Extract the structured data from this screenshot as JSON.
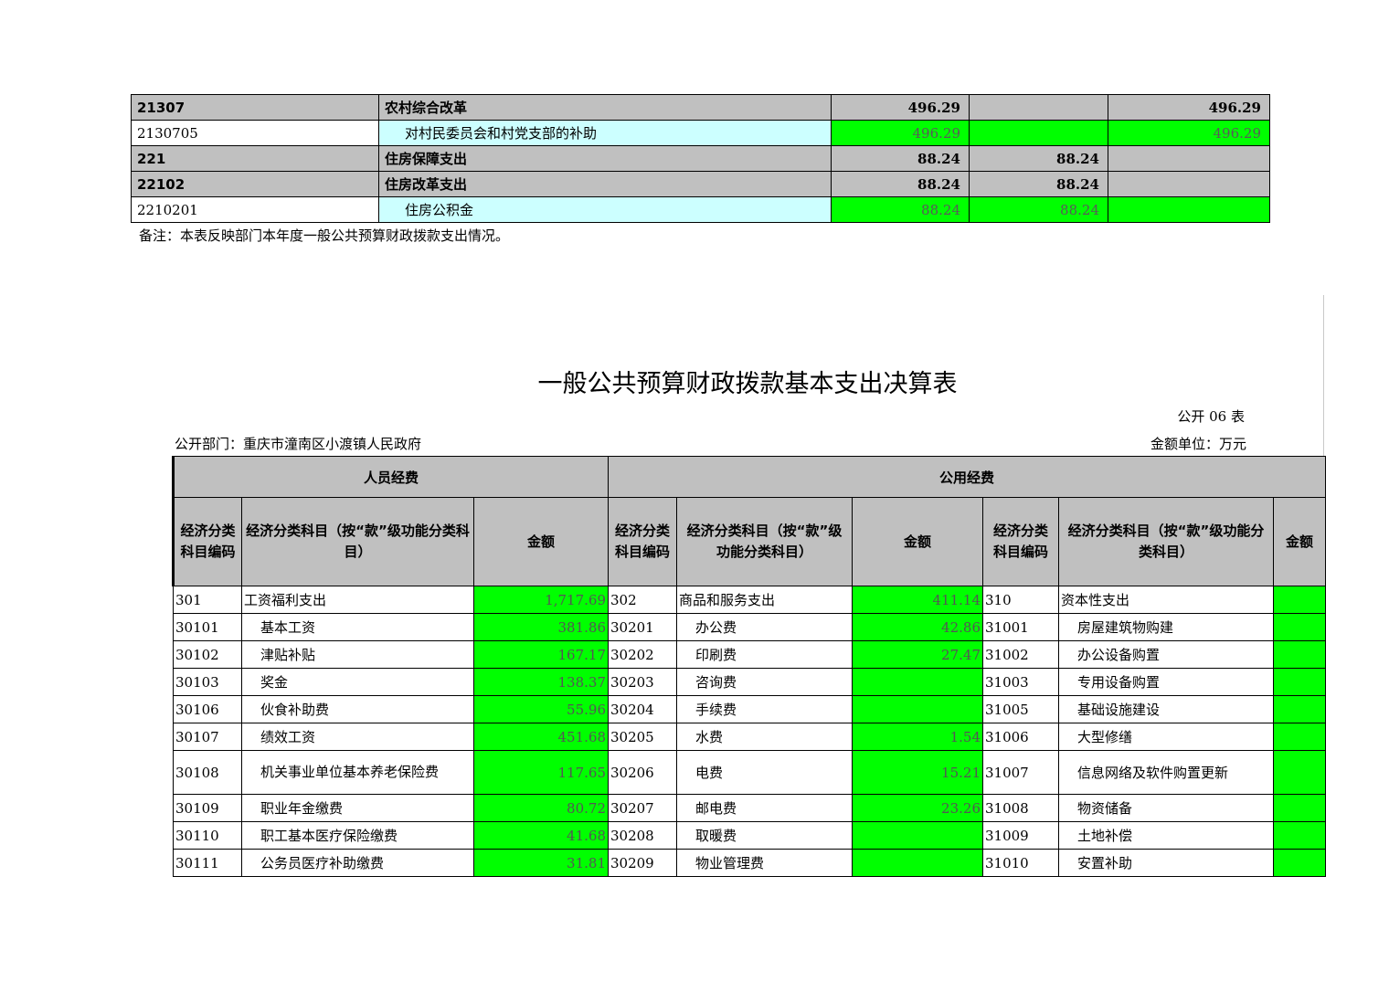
{
  "top_table": {
    "rows": [
      {
        "code": "21307",
        "name": "农村综合改革",
        "total": "496.29",
        "basic": "",
        "project": "496.29",
        "style": "bold"
      },
      {
        "code": "2130705",
        "name": "对村民委员会和村党支部的补助",
        "total": "496.29",
        "basic": "",
        "project": "496.29",
        "style": "leaf"
      },
      {
        "code": "221",
        "name": "住房保障支出",
        "total": "88.24",
        "basic": "88.24",
        "project": "",
        "style": "bold"
      },
      {
        "code": "22102",
        "name": "住房改革支出",
        "total": "88.24",
        "basic": "88.24",
        "project": "",
        "style": "bold"
      },
      {
        "code": "2210201",
        "name": "住房公积金",
        "total": "88.24",
        "basic": "88.24",
        "project": "",
        "style": "leaf"
      }
    ],
    "note": "备注：本表反映部门本年度一般公共预算财政拨款支出情况。"
  },
  "report": {
    "title": "一般公共预算财政拨款基本支出决算表",
    "form_no": "公开 06 表",
    "department": "公开部门：重庆市潼南区小渡镇人民政府",
    "unit": "金额单位：万元",
    "group_personnel": "人员经费",
    "group_public": "公用经费",
    "col_code_a": "经济分类科目编码",
    "col_name_a": "经济分类科目（按“款”级功能分类科目）",
    "col_amount_a": "金额",
    "col_code_b": "经济分类科目编码",
    "col_name_b": "经济分类科目（按“款”级功能分类科目）",
    "col_amount_b": "金额",
    "col_code_c": "经济分类科目编码",
    "col_name_c": "经济分类科目（按“款”级功能分类科目）",
    "col_amount_c": "金额",
    "rows": [
      {
        "c1": "301",
        "n1": "工资福利支出",
        "a1": "1,717.69",
        "c2": "302",
        "n2": "商品和服务支出",
        "a2": "411.14",
        "c3": "310",
        "n3": "资本性支出",
        "a3": ""
      },
      {
        "c1": "30101",
        "n1": "基本工资",
        "a1": "381.86",
        "c2": "30201",
        "n2": "办公费",
        "a2": "42.86",
        "c3": "31001",
        "n3": "房屋建筑物购建",
        "a3": ""
      },
      {
        "c1": "30102",
        "n1": "津贴补贴",
        "a1": "167.17",
        "c2": "30202",
        "n2": "印刷费",
        "a2": "27.47",
        "c3": "31002",
        "n3": "办公设备购置",
        "a3": ""
      },
      {
        "c1": "30103",
        "n1": "奖金",
        "a1": "138.37",
        "c2": "30203",
        "n2": "咨询费",
        "a2": "",
        "c3": "31003",
        "n3": "专用设备购置",
        "a3": ""
      },
      {
        "c1": "30106",
        "n1": "伙食补助费",
        "a1": "55.96",
        "c2": "30204",
        "n2": "手续费",
        "a2": "",
        "c3": "31005",
        "n3": "基础设施建设",
        "a3": ""
      },
      {
        "c1": "30107",
        "n1": "绩效工资",
        "a1": "451.68",
        "c2": "30205",
        "n2": "水费",
        "a2": "1.54",
        "c3": "31006",
        "n3": "大型修缮",
        "a3": ""
      },
      {
        "c1": "30108",
        "n1": "机关事业单位基本养老保险费",
        "a1": "117.65",
        "c2": "30206",
        "n2": "电费",
        "a2": "15.21",
        "c3": "31007",
        "n3": "信息网络及软件购置更新",
        "a3": ""
      },
      {
        "c1": "30109",
        "n1": "职业年金缴费",
        "a1": "80.72",
        "c2": "30207",
        "n2": "邮电费",
        "a2": "23.26",
        "c3": "31008",
        "n3": "物资储备",
        "a3": ""
      },
      {
        "c1": "30110",
        "n1": "职工基本医疗保险缴费",
        "a1": "41.68",
        "c2": "30208",
        "n2": "取暖费",
        "a2": "",
        "c3": "31009",
        "n3": "土地补偿",
        "a3": ""
      },
      {
        "c1": "30111",
        "n1": "公务员医疗补助缴费",
        "a1": "31.81",
        "c2": "30209",
        "n2": "物业管理费",
        "a2": "",
        "c3": "31010",
        "n3": "安置补助",
        "a3": ""
      }
    ]
  }
}
